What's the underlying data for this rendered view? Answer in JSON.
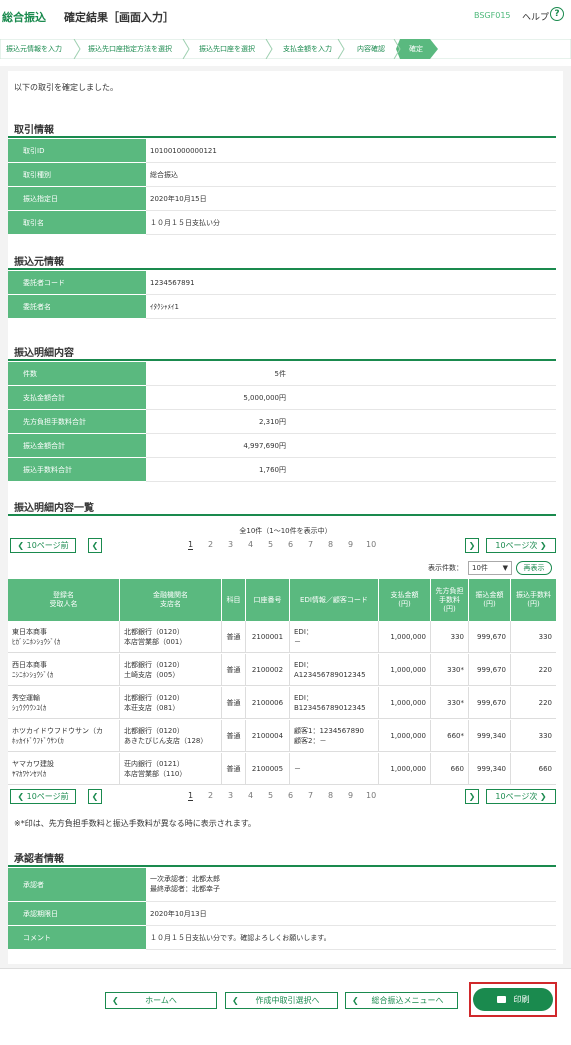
{
  "header": {
    "app_title": "総合振込",
    "page_title": "確定結果［画面入力］",
    "screen_id": "BSGF015",
    "help": "ヘルプ",
    "help_icon": "?"
  },
  "steps": [
    "振込元情報を入力",
    "振込先口座指定方法を選択",
    "振込先口座を選択",
    "支払金額を入力",
    "内容確認",
    "確定"
  ],
  "message": "以下の取引を確定しました。",
  "transaction": {
    "title": "取引情報",
    "rows": [
      {
        "label": "取引ID",
        "value": "101001000000121"
      },
      {
        "label": "取引種別",
        "value": "総合振込"
      },
      {
        "label": "振込指定日",
        "value": "2020年10月15日"
      },
      {
        "label": "取引名",
        "value": "１０月１５日支払い分"
      }
    ]
  },
  "source": {
    "title": "振込元情報",
    "rows": [
      {
        "label": "委託者コード",
        "value": "1234567891"
      },
      {
        "label": "委託者名",
        "value": "ｲﾀｸｼｬﾒｲ1"
      }
    ]
  },
  "detail": {
    "title": "振込明細内容",
    "rows": [
      {
        "label": "件数",
        "value": "5件"
      },
      {
        "label": "支払金額合計",
        "value": "5,000,000円"
      },
      {
        "label": "先方負担手数料合計",
        "value": "2,310円"
      },
      {
        "label": "振込金額合計",
        "value": "4,997,690円"
      },
      {
        "label": "振込手数料合計",
        "value": "1,760円"
      }
    ]
  },
  "list": {
    "title": "振込明細内容一覧",
    "paging_info": "全10件（1～10件を表示中）",
    "prev": "10ページ前",
    "next": "10ページ次",
    "pages": [
      "1",
      "2",
      "3",
      "4",
      "5",
      "6",
      "7",
      "8",
      "9",
      "10"
    ],
    "count_label": "表示件数：",
    "count_value": "10件",
    "redisplay": "再表示",
    "columns": [
      "登録名\n受取人名",
      "金融機関名\n支店名",
      "科目",
      "口座番号",
      "EDI情報／顧客コード",
      "支払金額\n(円)",
      "先方負担\n手数料\n(円)",
      "振込金額\n(円)",
      "振込手数料\n(円)"
    ],
    "rows": [
      {
        "name": "東日本商事",
        "kana": "ﾋｶﾞｼﾆﾎﾝｼｮｳｼﾞ(ｶ",
        "bank": "北都銀行（0120）",
        "branch": "本店営業部（001）",
        "type": "普通",
        "account": "2100001",
        "edi1": "EDI：",
        "edi2": "－",
        "pay": "1,000,000",
        "fee": "330",
        "transfer": "999,670",
        "tfee": "330"
      },
      {
        "name": "西日本商事",
        "kana": "ﾆｼﾆﾎﾝｼｮｳｼﾞ(ｶ",
        "bank": "北都銀行（0120）",
        "branch": "土崎支店（005）",
        "type": "普通",
        "account": "2100002",
        "edi1": "EDI：",
        "edi2": "A123456789012345",
        "pay": "1,000,000",
        "fee": "330*",
        "transfer": "999,670",
        "tfee": "220"
      },
      {
        "name": "秀空運輸",
        "kana": "ｼｭｳｸｳｳﾝﾕ(ｶ",
        "bank": "北都銀行（0120）",
        "branch": "本荘支店（081）",
        "type": "普通",
        "account": "2100006",
        "edi1": "EDI：",
        "edi2": "B123456789012345",
        "pay": "1,000,000",
        "fee": "330*",
        "transfer": "999,670",
        "tfee": "220"
      },
      {
        "name": "ホツカイドウフドウサン（カ",
        "kana": "ﾎｯｶｲﾄﾞｳﾌﾄﾞｳｻﾝ(ｶ",
        "bank": "北都銀行（0120）",
        "branch": "あきたびじん支店（128）",
        "type": "普通",
        "account": "2100004",
        "edi1": "顧客1：1234567890",
        "edi2": "顧客2：－",
        "pay": "1,000,000",
        "fee": "660*",
        "transfer": "999,340",
        "tfee": "330"
      },
      {
        "name": "ヤマカワ建設",
        "kana": "ﾔﾏｶﾜｹﾝｾﾂ(ｶ",
        "bank": "荘内銀行（0121）",
        "branch": "本店営業部（110）",
        "type": "普通",
        "account": "2100005",
        "edi1": "－",
        "edi2": "",
        "pay": "1,000,000",
        "fee": "660",
        "transfer": "999,340",
        "tfee": "660"
      }
    ]
  },
  "note": "※*印は、先方負担手数料と振込手数料が異なる時に表示されます。",
  "approver": {
    "title": "承認者情報",
    "rows": [
      {
        "label": "承認者",
        "line1": "一次承認者：北都太郎",
        "line2": "最終承認者：北都幸子"
      },
      {
        "label": "承認期限日",
        "line1": "2020年10月13日",
        "line2": ""
      },
      {
        "label": "コメント",
        "line1": "１０月１５日支払い分です。確認よろしくお願いします。",
        "line2": ""
      }
    ]
  },
  "footer": {
    "home": "ホームへ",
    "select": "作成中取引選択へ",
    "menu": "総合振込メニューへ",
    "print": "印刷"
  },
  "colors": {
    "accent": "#1a8a4e",
    "label_bg": "#5ab97f",
    "highlight": "#d0282b"
  }
}
